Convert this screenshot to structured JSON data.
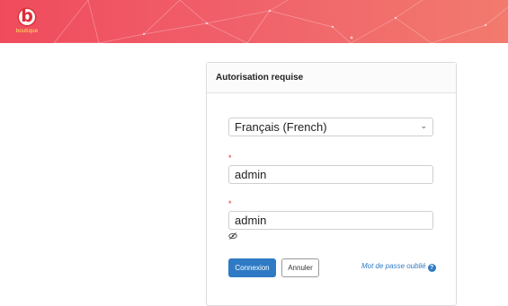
{
  "header": {
    "logo_letter": "b",
    "logo_wordmark": "boutique",
    "colors": {
      "gradient_start": "#ef4b5c",
      "gradient_end": "#f27a6e"
    }
  },
  "login": {
    "title": "Autorisation requise",
    "language": {
      "selected": "Français (French)",
      "chevron_icon": "chevron-down-icon"
    },
    "required_marker": "*",
    "username_value": "admin",
    "password_value": "admin",
    "show_password_icon": "eye-slash-icon",
    "connect_label": "Connexion",
    "cancel_label": "Annuler",
    "forgot_label": "Mot de passe oublié",
    "help_icon": "question-circle-icon",
    "help_glyph": "?",
    "primary_color": "#2f7ac4",
    "required_color": "#e3342f"
  }
}
